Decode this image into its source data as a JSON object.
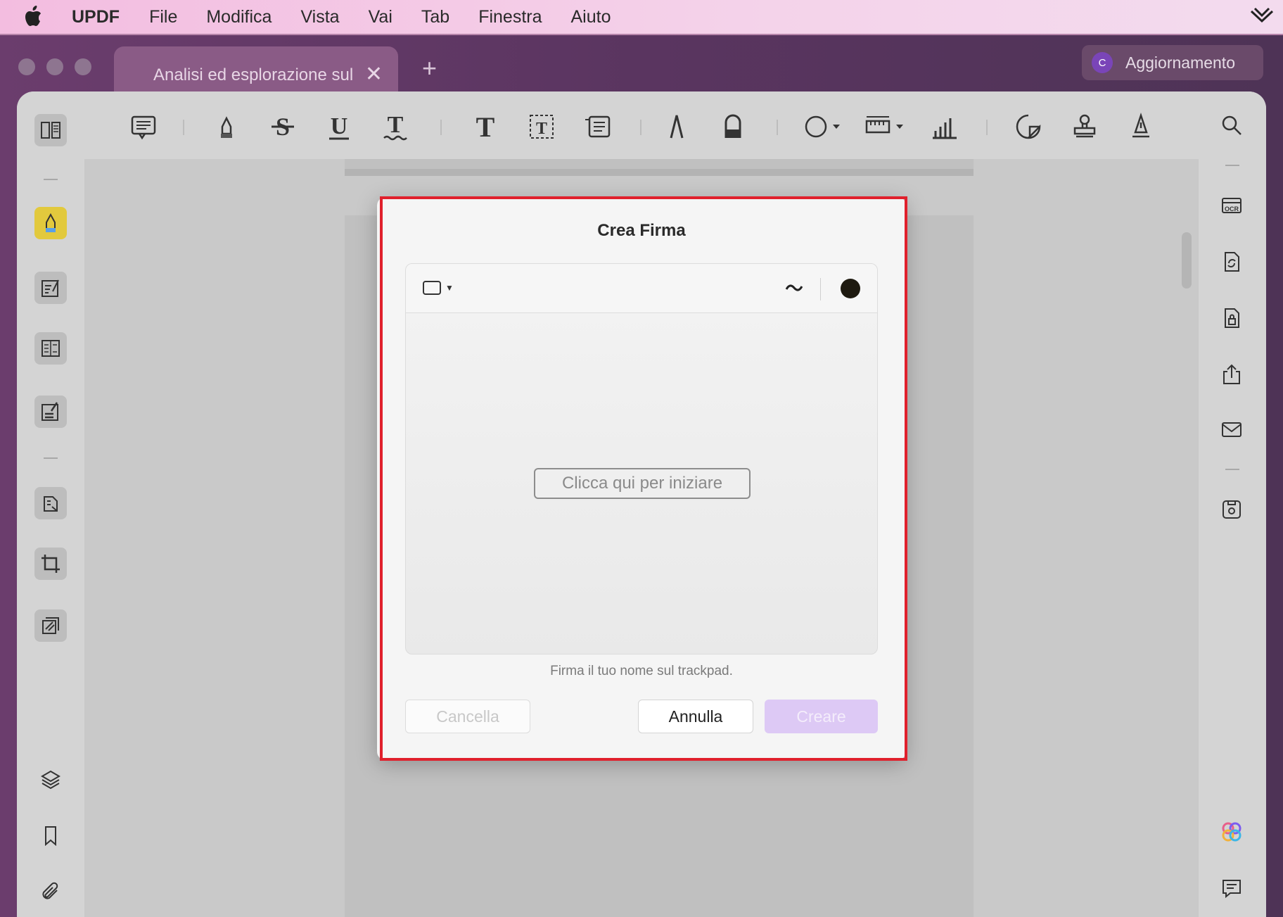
{
  "menubar": {
    "app_name": "UPDF",
    "items": [
      "File",
      "Modifica",
      "Vista",
      "Vai",
      "Tab",
      "Finestra",
      "Aiuto"
    ]
  },
  "window": {
    "tab_title": "Analisi ed esplorazione sul",
    "upgrade_label": "Aggiornamento",
    "avatar_letter": "C"
  },
  "dialog": {
    "title": "Crea Firma",
    "start_button": "Clicca qui per iniziare",
    "hint": "Firma il tuo nome sul trackpad.",
    "clear_button": "Cancella",
    "cancel_button": "Annulla",
    "create_button": "Creare",
    "ink_color": "#1e1a10"
  },
  "colors": {
    "highlight": "#e0202c",
    "active_tool": "#e2c93d",
    "create_button_bg": "#ddc9f5"
  }
}
